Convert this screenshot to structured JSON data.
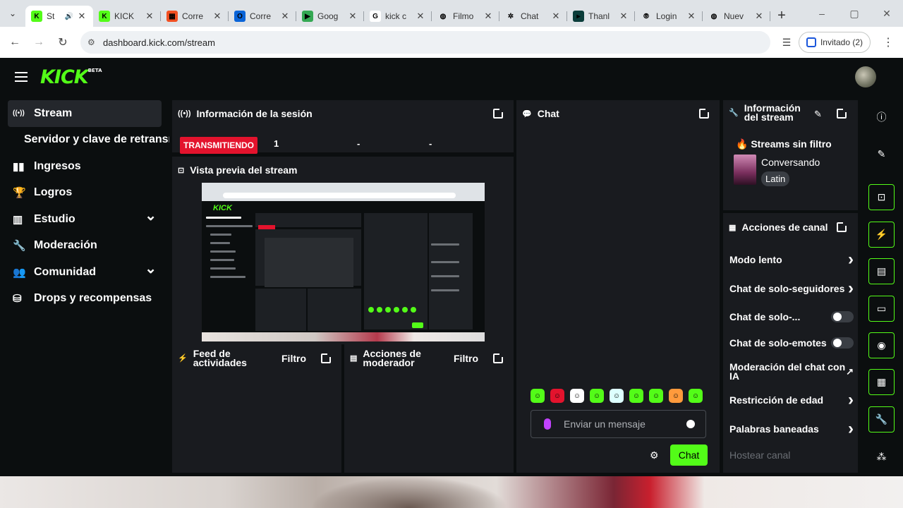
{
  "browser": {
    "tabs": [
      {
        "title": "St",
        "favicon": "kick",
        "active": true
      },
      {
        "title": "KICK",
        "favicon": "kick"
      },
      {
        "title": "Corre",
        "favicon": "microsoft"
      },
      {
        "title": "Corre",
        "favicon": "outlook"
      },
      {
        "title": "Goog",
        "favicon": "play"
      },
      {
        "title": "kick c",
        "favicon": "google"
      },
      {
        "title": "Filmo",
        "favicon": "globe"
      },
      {
        "title": "Chat",
        "favicon": "openai"
      },
      {
        "title": "Thanl",
        "favicon": "app"
      },
      {
        "title": "Login",
        "favicon": "fingerprint"
      },
      {
        "title": "Nuev",
        "favicon": "globe"
      }
    ],
    "url": "dashboard.kick.com/stream",
    "profile_label": "Invitado (2)"
  },
  "app": {
    "logo": "KICK",
    "logo_badge": "BETA",
    "sidebar": [
      {
        "label": "Stream",
        "icon": "broadcast-icon",
        "active": true
      },
      {
        "label": "Servidor y clave de retransm",
        "sub": true
      },
      {
        "label": "Ingresos",
        "icon": "chart-icon"
      },
      {
        "label": "Logros",
        "icon": "trophy-icon"
      },
      {
        "label": "Estudio",
        "icon": "studio-icon",
        "expandable": true
      },
      {
        "label": "Moderación",
        "icon": "wrench-icon"
      },
      {
        "label": "Comunidad",
        "icon": "users-icon",
        "expandable": true
      },
      {
        "label": "Drops y recompensas",
        "icon": "gift-icon"
      }
    ],
    "session_panel": {
      "title": "Información de la sesión",
      "live_badge": "TRANSMITIENDO",
      "stats": [
        "1",
        "-",
        "-"
      ]
    },
    "preview_panel": {
      "title": "Vista previa del stream"
    },
    "activity_panel": {
      "title_line1": "Feed de",
      "title_line2": "actividades",
      "filter": "Filtro"
    },
    "mod_actions_panel": {
      "title_line1": "Acciones de",
      "title_line2": "moderador",
      "filter": "Filtro"
    },
    "chat_panel": {
      "title": "Chat",
      "placeholder": "Enviar un mensaje",
      "send_label": "Chat"
    },
    "stream_info": {
      "title_line1": "Información",
      "title_line2": "del stream",
      "stream_title": "Streams sin filtro",
      "category": "Conversando",
      "tag": "Latin"
    },
    "channel_actions": {
      "title": "Acciones de canal",
      "rows": [
        {
          "label": "Modo lento",
          "control": "arrow"
        },
        {
          "label": "Chat de solo-seguidores",
          "control": "arrow"
        },
        {
          "label": "Chat de solo-...",
          "control": "toggle"
        },
        {
          "label": "Chat de solo-emotes",
          "control": "toggle"
        },
        {
          "label": "Moderación del chat con IA",
          "control": "popout"
        },
        {
          "label": "Restricción de edad",
          "control": "arrow"
        },
        {
          "label": "Palabras baneadas",
          "control": "arrow"
        },
        {
          "label": "Hostear canal",
          "control": "none"
        }
      ]
    },
    "colors": {
      "accent": "#53fc18",
      "live": "#e3132d",
      "panel": "#191b1f",
      "background": "#0b0e0f"
    }
  }
}
